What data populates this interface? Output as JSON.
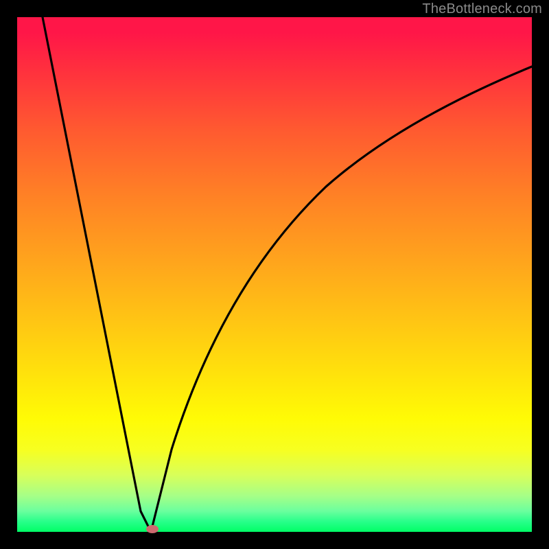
{
  "watermark": "TheBottleneck.com",
  "colors": {
    "frame": "#000000",
    "gradient_top": "#ff1648",
    "gradient_mid": "#ffe40b",
    "gradient_bottom": "#00ff66",
    "curve": "#000000",
    "marker": "#cc6a6f",
    "watermark_text": "#8a8a8a"
  },
  "chart_data": {
    "type": "line",
    "title": "",
    "xlabel": "",
    "ylabel": "",
    "xlim": [
      0,
      100
    ],
    "ylim": [
      0,
      100
    ],
    "series": [
      {
        "name": "bottleneck-curve",
        "x": [
          5,
          10,
          15,
          20,
          24,
          26,
          30,
          35,
          40,
          45,
          50,
          55,
          60,
          65,
          70,
          75,
          80,
          85,
          90,
          95,
          100
        ],
        "y": [
          100,
          79,
          58,
          37,
          4,
          0,
          16,
          35,
          49,
          59,
          67,
          73,
          78,
          81,
          84,
          86,
          87.5,
          88.5,
          89.5,
          90,
          90.5
        ]
      }
    ],
    "marker": {
      "x": 26,
      "y": 0
    },
    "notes": "y is bottleneck percentage (0 at green bottom, 100 at red top). Curve drops linearly from top-left to a minimum near x≈26, then rises with diminishing slope toward the right."
  }
}
